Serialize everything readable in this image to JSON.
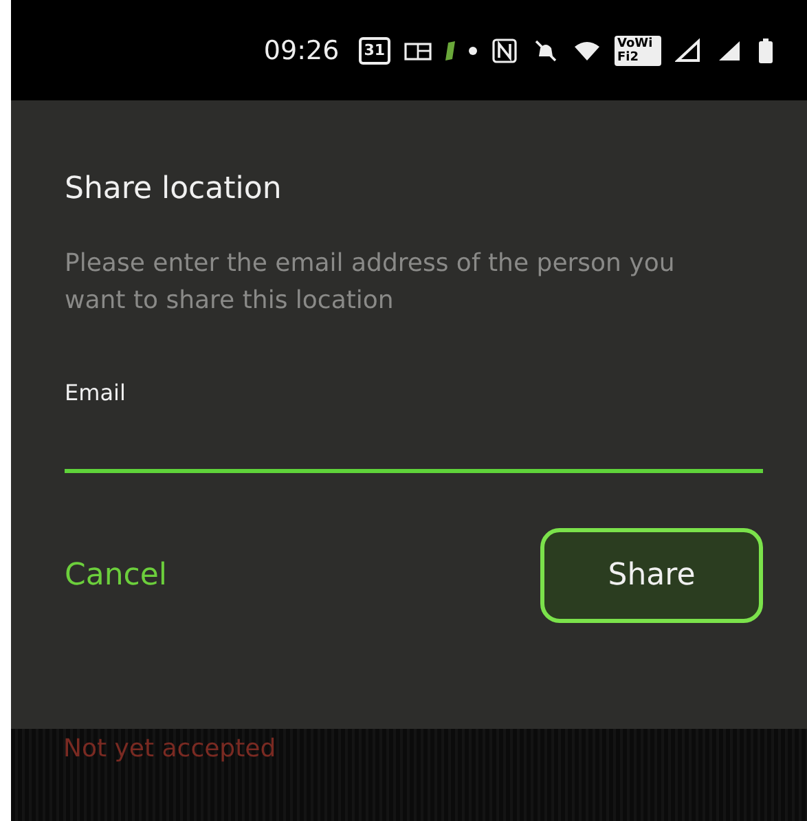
{
  "status_bar": {
    "time": "09:26",
    "calendar_day": "31",
    "wifi_calling": "VoWiFi2"
  },
  "dialog": {
    "title": "Share location",
    "message": "Please enter the email address of the person you want to share this location",
    "field": {
      "label": "Email",
      "focused": true
    },
    "buttons": [
      {
        "label": "Cancel",
        "kind": "text"
      },
      {
        "label": "Share",
        "kind": "outlined"
      }
    ]
  },
  "background_list": {
    "status": "Not yet accepted"
  }
}
